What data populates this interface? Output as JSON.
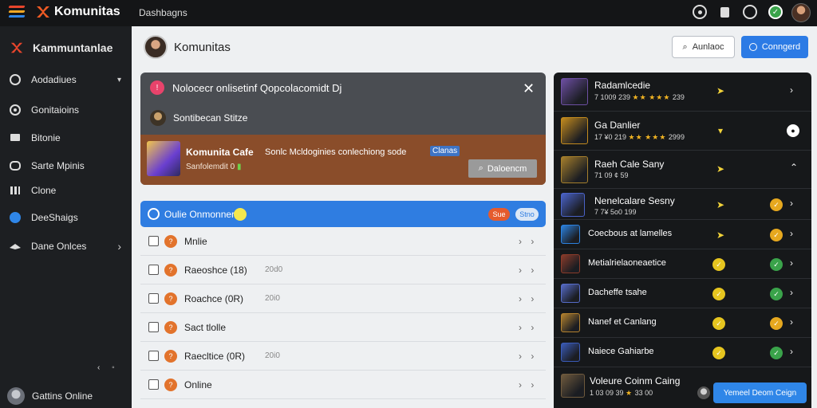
{
  "topbar": {
    "brand": "Komunitas",
    "section": "Dashbagns",
    "icons": [
      "compass-icon",
      "bookmark-icon",
      "chat-icon",
      "verified-icon",
      "user-avatar"
    ]
  },
  "sidebar": {
    "header": "Kammuntanlae",
    "items": [
      {
        "label": "Aodadiues",
        "icon": "palette-icon",
        "arrow": "▾"
      },
      {
        "label": "Gonitaioins",
        "icon": "gamepad-icon",
        "arrow": ""
      },
      {
        "label": "Bitonie",
        "icon": "monitor-icon",
        "arrow": ""
      },
      {
        "label": "Sarte Mpinis",
        "icon": "controller-icon",
        "arrow": ""
      },
      {
        "label": "Clone",
        "icon": "library-icon",
        "arrow": ""
      },
      {
        "label": "DeeShaigs",
        "icon": "globe-icon",
        "arrow": ""
      },
      {
        "label": "Dane Onlces",
        "icon": "hat-icon",
        "arrow": "›"
      }
    ],
    "footer_label": "Gattins Online"
  },
  "header": {
    "title": "Komunitas",
    "btn_secondary": "Aunlaoc",
    "btn_primary": "Conngerd"
  },
  "notice": {
    "line1": "Nolocecr onlisetinf Qopcolacomidt Dj",
    "line2": "Sontibecan Stitze",
    "game_title": "Komunita Cafe",
    "game_desc": "Sonlc Mcldoginies conlechiong sode",
    "game_tag": "Clanas",
    "game_meta": "Sanfolemdit 0",
    "button": "Daloencm"
  },
  "online_list": {
    "title": "Oulie Onmonner",
    "pill1": "Sue",
    "pill2": "Stno",
    "rows": [
      {
        "label": "Mnlie",
        "meta": ""
      },
      {
        "label": "Raeoshce (18)",
        "meta": "20d0"
      },
      {
        "label": "Roachce (0R)",
        "meta": "20i0"
      },
      {
        "label": "Sact tlolle",
        "meta": ""
      },
      {
        "label": "Raecltice (0R)",
        "meta": "20i0"
      },
      {
        "label": "Online",
        "meta": ""
      }
    ]
  },
  "right_panel": {
    "rows": [
      {
        "title": "Radamlcedie",
        "sub": "7 1009 239 ★★ ★★★ 239",
        "thumb": "#6d4fa3"
      },
      {
        "title": "Ga Danlier",
        "sub": "17 ¥0 219 ★★ ★★★ 2999",
        "thumb": "#c38b1e"
      },
      {
        "title": "Raeh Cale Sany",
        "sub": "71 09 ¢ 59",
        "thumb": "#a57f2c"
      },
      {
        "title": "Nenelcalare Sesny",
        "sub": "7 7¥ 5o0 199",
        "thumb": "#4a63c9"
      },
      {
        "title": "Coecbous at lamelles",
        "sub": "",
        "thumb": "#2c82e0"
      },
      {
        "title": "Metialrielaoneaetice",
        "sub": "",
        "thumb": "#8a3b2a"
      },
      {
        "title": "Dacheffe tsahe",
        "sub": "",
        "thumb": "#566cc8"
      },
      {
        "title": "Nanef et Canlang",
        "sub": "",
        "thumb": "#b3812e"
      },
      {
        "title": "Naiece Gahiarbe",
        "sub": "",
        "thumb": "#3a5bb8"
      },
      {
        "title": "Voleure Coinm Caing",
        "sub": "1 03 09 39 ★ 33 00",
        "thumb": "#6f5a3d"
      }
    ],
    "cta": "Yemeel Deom Ceign"
  }
}
